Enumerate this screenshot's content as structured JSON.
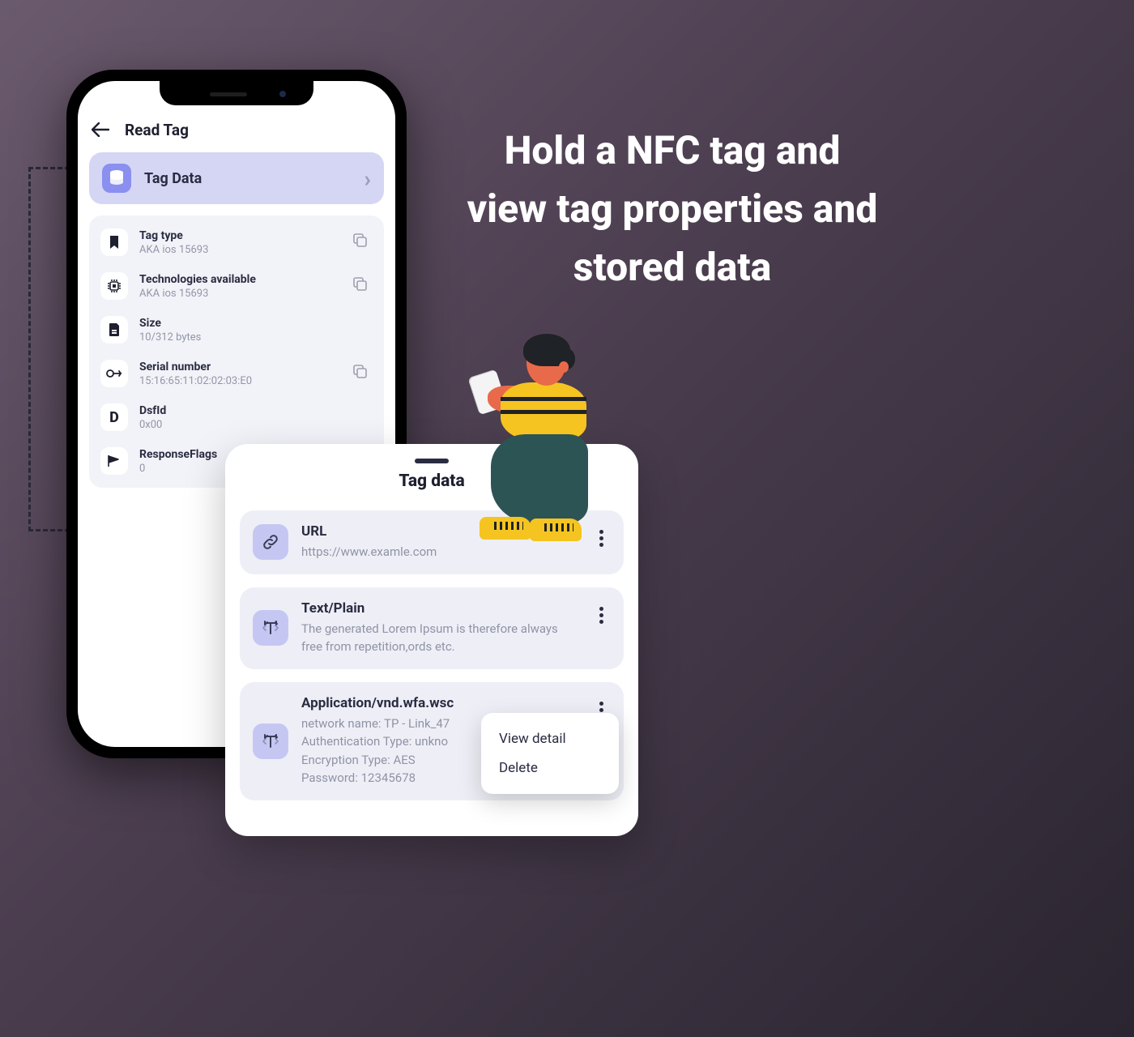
{
  "headline": "Hold a NFC tag and view tag properties and stored data",
  "phone": {
    "title": "Read Tag",
    "banner": {
      "label": "Tag Data"
    },
    "properties": [
      {
        "label": "Tag type",
        "value": "AKA ios 15693",
        "copyable": true,
        "icon": "bookmark"
      },
      {
        "label": "Technologies available",
        "value": "AKA ios 15693",
        "copyable": true,
        "icon": "chip"
      },
      {
        "label": "Size",
        "value": "10/312 bytes",
        "copyable": false,
        "icon": "storage"
      },
      {
        "label": "Serial number",
        "value": "15:16:65:11:02:02:03:E0",
        "copyable": true,
        "icon": "key"
      },
      {
        "label": "DsfId",
        "value": "0x00",
        "copyable": false,
        "icon": "letter-d"
      },
      {
        "label": "ResponseFlags",
        "value": "0",
        "copyable": false,
        "icon": "flag"
      }
    ]
  },
  "modal": {
    "title": "Tag data",
    "records": [
      {
        "title": "URL",
        "text": "https://www.examle.com",
        "icon": "link"
      },
      {
        "title": "Text/Plain",
        "text": "The generated Lorem Ipsum is therefore always free from repetition,ords etc.",
        "icon": "text"
      },
      {
        "title": "Application/vnd.wfa.wsc",
        "text": "network name: TP - Link_47\nAuthentication Type: unkno\nEncryption Type: AES\nPassword: 12345678",
        "icon": "text"
      }
    ]
  },
  "context_menu": {
    "items": [
      "View detail",
      "Delete"
    ]
  }
}
